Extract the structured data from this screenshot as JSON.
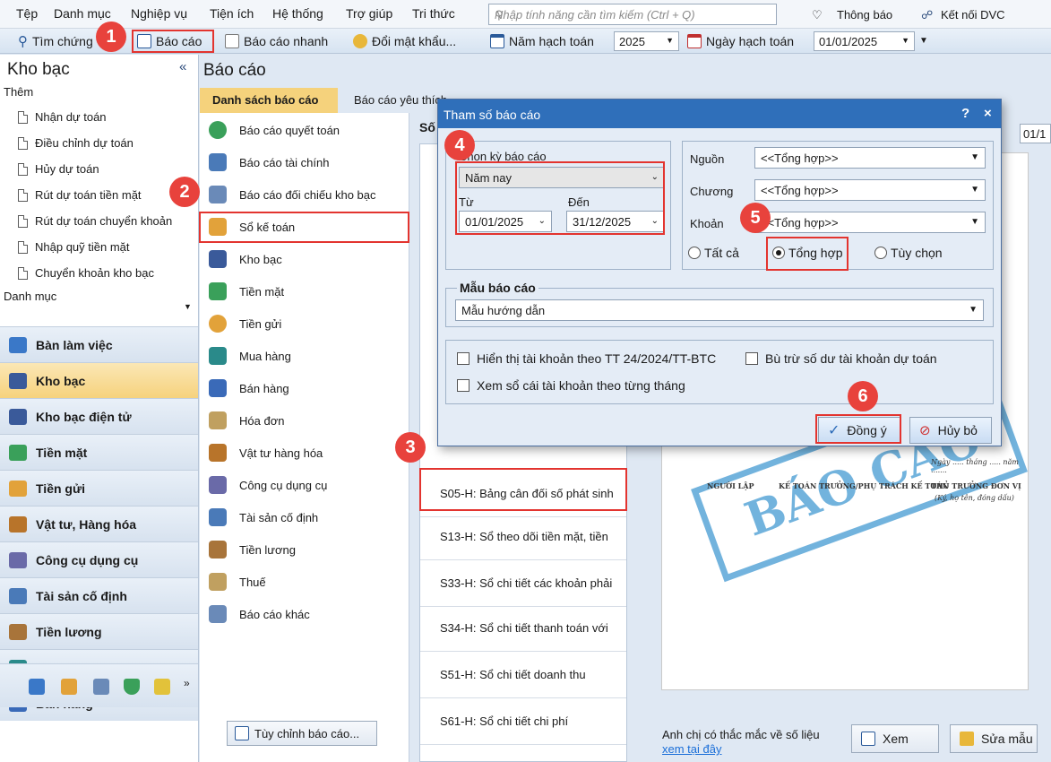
{
  "menu": [
    "Tệp",
    "Danh mục",
    "Nghiệp vụ",
    "Tiện ích",
    "Hệ thống",
    "Trợ giúp",
    "Tri thức"
  ],
  "search": {
    "placeholder": "Nhập tính năng cần tìm kiếm (Ctrl + Q)"
  },
  "top_right": {
    "notifications": "Thông báo",
    "connect": "Kết nối DVC"
  },
  "toolbar": {
    "voucher_search": "Tìm chứng",
    "reports": "Báo cáo",
    "quick_reports": "Báo cáo nhanh",
    "change_password": "Đổi mật khẩu...",
    "fiscal_year_label": "Năm hạch toán",
    "fiscal_year_value": "2025",
    "posting_date_label": "Ngày hạch toán",
    "posting_date_value": "01/01/2025"
  },
  "sidebar": {
    "title": "Kho bạc",
    "add_section": "Thêm",
    "links": [
      "Nhận dự toán",
      "Điều chỉnh dự toán",
      "Hủy dự toán",
      "Rút dự toán tiền mặt",
      "Rút dự toán chuyển khoản",
      "Nhập quỹ tiền mặt",
      "Chuyển khoản kho bạc"
    ],
    "catalog_section": "Danh mục",
    "modules": [
      "Bàn làm việc",
      "Kho bạc",
      "Kho bạc điện tử",
      "Tiền mặt",
      "Tiền gửi",
      "Vật tư, Hàng hóa",
      "Công cụ dụng cụ",
      "Tài sản cố định",
      "Tiền lương",
      "Mua hàng",
      "Bán hàng"
    ]
  },
  "main": {
    "title": "Báo cáo",
    "tabs": [
      "Danh sách báo cáo",
      "Báo cáo yêu thích"
    ],
    "categories": [
      "Báo cáo quyết toán",
      "Báo cáo tài chính",
      "Báo cáo đối chiếu kho bạc",
      "Sổ kế toán",
      "Kho bạc",
      "Tiền mặt",
      "Tiền gửi",
      "Mua hàng",
      "Bán hàng",
      "Hóa đơn",
      "Vật tư hàng hóa",
      "Công cụ dụng cụ",
      "Tài sản cố định",
      "Tiền lương",
      "Thuế",
      "Báo cáo khác"
    ],
    "custom_button": "Tùy chỉnh báo cáo...",
    "report_header": "Số",
    "reports": [
      "S05-H: Bảng cân đối số phát sinh",
      "S13-H: Sổ theo dõi tiền mặt, tiền",
      "S33-H: Sổ chi tiết các khoản phải",
      "S34-H: Sổ chi tiết thanh toán với",
      "S51-H: Sổ chi tiết doanh thu",
      "S61-H: Sổ chi tiết chi phí"
    ],
    "preview_date": "01/1",
    "help_text": "Anh chị có thắc mắc về số liệu",
    "help_link": "xem tại đây",
    "view_button": "Xem",
    "edit_template_button": "Sửa mẫu"
  },
  "preview": {
    "stamp": "BÁO CÁO",
    "sig_preparer": "NGƯỜI LẬP",
    "sig_chief_accountant": "KẾ TOÁN TRƯỞNG/PHỤ TRÁCH KẾ TOÁN",
    "sig_head": "THỦ TRƯỞNG ĐƠN VỊ",
    "date_line": "Ngày ..... tháng ..... năm .......",
    "sig_note": "(Ký, họ tên, đóng dấu)"
  },
  "dialog": {
    "title": "Tham số báo cáo",
    "help": "?",
    "close": "×",
    "period_label": "Chọn kỳ báo cáo",
    "period_value": "Năm nay",
    "from_label": "Từ",
    "from_value": "01/01/2025",
    "to_label": "Đến",
    "to_value": "31/12/2025",
    "source_label": "Nguồn",
    "source_value": "<<Tổng hợp>>",
    "chapter_label": "Chương",
    "chapter_value": "<<Tổng hợp>>",
    "item_label": "Khoản",
    "item_value": "<<Tổng hợp>>",
    "radio_all": "Tất cả",
    "radio_summary": "Tổng hợp",
    "radio_custom": "Tùy chọn",
    "selected_radio": "Tổng hợp",
    "template_label": "Mẫu báo cáo",
    "template_value": "Mẫu hướng dẫn",
    "chk_show_accounts": "Hiển thị tài khoản theo TT 24/2024/TT-BTC",
    "chk_offset_balance": "Bù trừ số dư tài khoản dự toán",
    "chk_ledger_monthly": "Xem sổ cái tài khoản theo từng tháng",
    "ok": "Đồng ý",
    "cancel": "Hủy bỏ"
  },
  "callouts": [
    "1",
    "2",
    "3",
    "4",
    "5",
    "6"
  ],
  "colors": {
    "accent": "#2f6fba",
    "active_tab": "#f5d27c",
    "callout": "#e8423c",
    "highlight": "#e3342f",
    "stamp": "#5aa6d8"
  }
}
